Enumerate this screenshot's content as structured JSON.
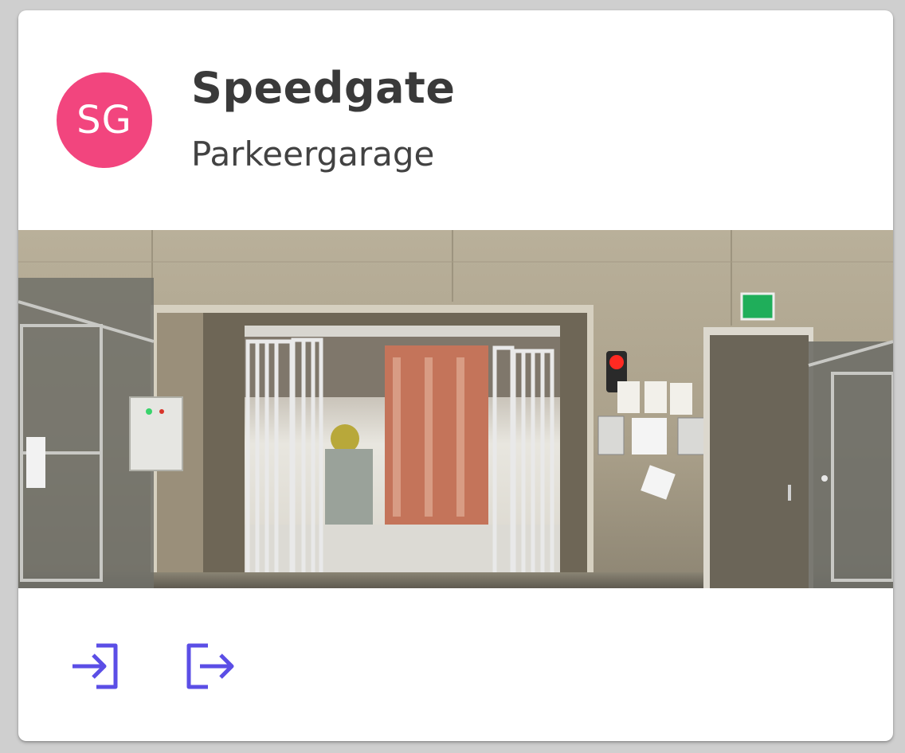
{
  "card": {
    "avatar_initials": "SG",
    "avatar_color": "#f2457e",
    "title": "Speedgate",
    "subtitle": "Parkeergarage"
  },
  "media": {
    "image_description": "photo-garage-speedgate"
  },
  "actions": [
    {
      "name": "login-icon",
      "icon": "login"
    },
    {
      "name": "logout-icon",
      "icon": "logout"
    }
  ],
  "colors": {
    "accent": "#5b4ee6",
    "text_primary": "#3a3a3a",
    "background": "#cfcfcf",
    "card": "#ffffff"
  }
}
